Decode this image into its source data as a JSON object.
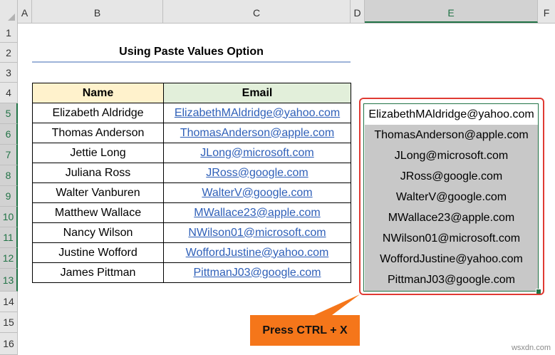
{
  "columns": [
    "A",
    "B",
    "C",
    "D",
    "E",
    "F"
  ],
  "rows": [
    "1",
    "2",
    "3",
    "4",
    "5",
    "6",
    "7",
    "8",
    "9",
    "10",
    "11",
    "12",
    "13",
    "14",
    "15",
    "16"
  ],
  "title": "Using Paste Values Option",
  "table": {
    "headers": {
      "name": "Name",
      "email": "Email"
    },
    "rows": [
      {
        "name": "Elizabeth Aldridge",
        "email": "ElizabethMAldridge@yahoo.com"
      },
      {
        "name": "Thomas Anderson",
        "email": "ThomasAnderson@apple.com"
      },
      {
        "name": "Jettie Long",
        "email": "JLong@microsoft.com"
      },
      {
        "name": "Juliana Ross",
        "email": "JRoss@google.com"
      },
      {
        "name": "Walter Vanburen",
        "email": "WalterV@google.com"
      },
      {
        "name": "Matthew Wallace",
        "email": "MWallace23@apple.com"
      },
      {
        "name": "Nancy Wilson",
        "email": "NWilson01@microsoft.com"
      },
      {
        "name": "Justine Wofford",
        "email": "WoffordJustine@yahoo.com"
      },
      {
        "name": "James Pittman",
        "email": "PittmanJ03@google.com"
      }
    ]
  },
  "column_e": [
    "ElizabethMAldridge@yahoo.com",
    "ThomasAnderson@apple.com",
    "JLong@microsoft.com",
    "JRoss@google.com",
    "WalterV@google.com",
    "MWallace23@apple.com",
    "NWilson01@microsoft.com",
    "WoffordJustine@yahoo.com",
    "PittmanJ03@google.com"
  ],
  "callout": "Press CTRL + X",
  "watermark": "wsxdn.com",
  "colors": {
    "accent": "#217346",
    "highlight_outline": "#e03a33",
    "callout": "#f5761a",
    "name_header": "#fff2cc",
    "email_header": "#e2efda",
    "link": "#2e5fb8"
  }
}
